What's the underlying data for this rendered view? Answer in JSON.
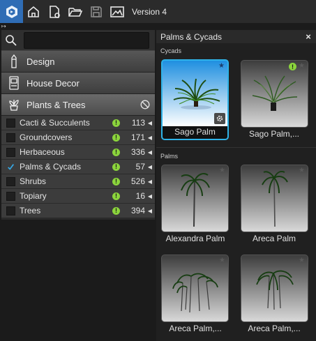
{
  "toolbar": {
    "version": "Version 4",
    "icons": [
      "logo-icon",
      "home-icon",
      "new-document-icon",
      "open-folder-icon",
      "save-icon",
      "image-icon"
    ]
  },
  "search": {
    "value": "",
    "placeholder": ""
  },
  "categories": [
    {
      "label": "Design",
      "icon": "pencil-icon"
    },
    {
      "label": "House Decor",
      "icon": "appliance-icon"
    },
    {
      "label": "Plants & Trees",
      "icon": "plant-pot-icon"
    }
  ],
  "subcategories": [
    {
      "label": "Cacti & Succulents",
      "count": "113",
      "checked": false
    },
    {
      "label": "Groundcovers",
      "count": "171",
      "checked": false
    },
    {
      "label": "Herbaceous",
      "count": "336",
      "checked": false
    },
    {
      "label": "Palms & Cycads",
      "count": "57",
      "checked": true
    },
    {
      "label": "Shrubs",
      "count": "526",
      "checked": false
    },
    {
      "label": "Topiary",
      "count": "16",
      "checked": false
    },
    {
      "label": "Trees",
      "count": "394",
      "checked": false
    }
  ],
  "panel": {
    "title": "Palms & Cycads",
    "close": "×",
    "sections": [
      {
        "label": "Cycads",
        "items": [
          {
            "caption": "Sago Palm",
            "selected": true
          },
          {
            "caption": "Sago Palm,..."
          }
        ]
      },
      {
        "label": "Palms",
        "items": [
          {
            "caption": "Alexandra Palm"
          },
          {
            "caption": "Areca Palm"
          },
          {
            "caption": "Areca Palm,..."
          },
          {
            "caption": "Areca Palm,..."
          }
        ]
      }
    ]
  },
  "colors": {
    "accent": "#2fb3e8",
    "warning": "#8bd43c",
    "brand": "#2f6db5"
  }
}
